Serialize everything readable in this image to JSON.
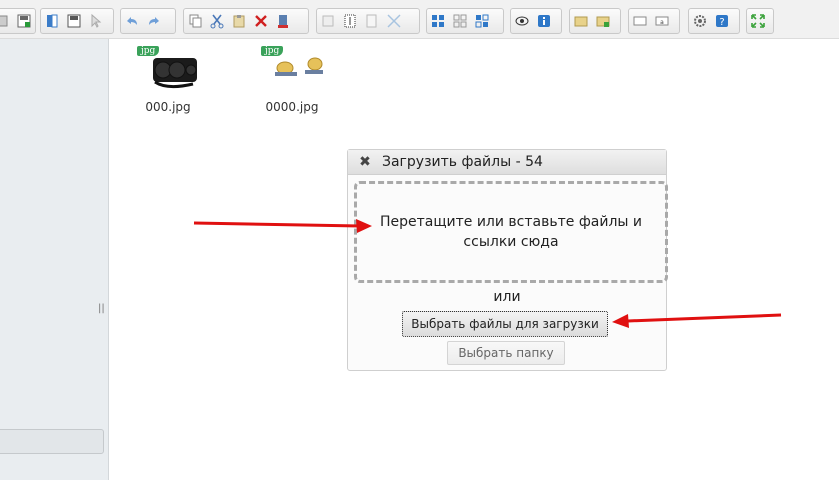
{
  "files": [
    {
      "ext": "jpg",
      "name": "000.jpg",
      "icon": "radiator-image"
    },
    {
      "ext": "jpg",
      "name": "0000.jpg",
      "icon": "coins-image"
    }
  ],
  "dialog": {
    "title": "Загрузить файлы - 54",
    "close_icon": "close-icon",
    "dropzone_text": "Перетащите или вставьте файлы и ссылки сюда",
    "or_text": "или",
    "choose_files_label": "Выбрать файлы для загрузки",
    "choose_folder_label": "Выбрать папку"
  },
  "sidebar": {
    "resizer_glyph": "||"
  },
  "colors": {
    "accent_arrow": "#e01010",
    "badge": "#3aa25a"
  },
  "toolbar_icons": [
    "home-icon",
    "save-icon",
    "open-icon",
    "save-as-icon",
    "select-icon",
    "undo-icon",
    "redo-icon",
    "copy-icon",
    "cut-icon",
    "paste-icon",
    "delete-icon",
    "empty-icon",
    "duplicate-icon",
    "rename-icon",
    "edit-icon",
    "resize-icon",
    "view-icons-icon",
    "view-list-icon",
    "view-details-icon",
    "preview-icon",
    "info-icon",
    "extract-icon",
    "archive-icon",
    "select-all-icon",
    "search-icon",
    "settings-icon",
    "help-icon",
    "fullscreen-icon"
  ]
}
